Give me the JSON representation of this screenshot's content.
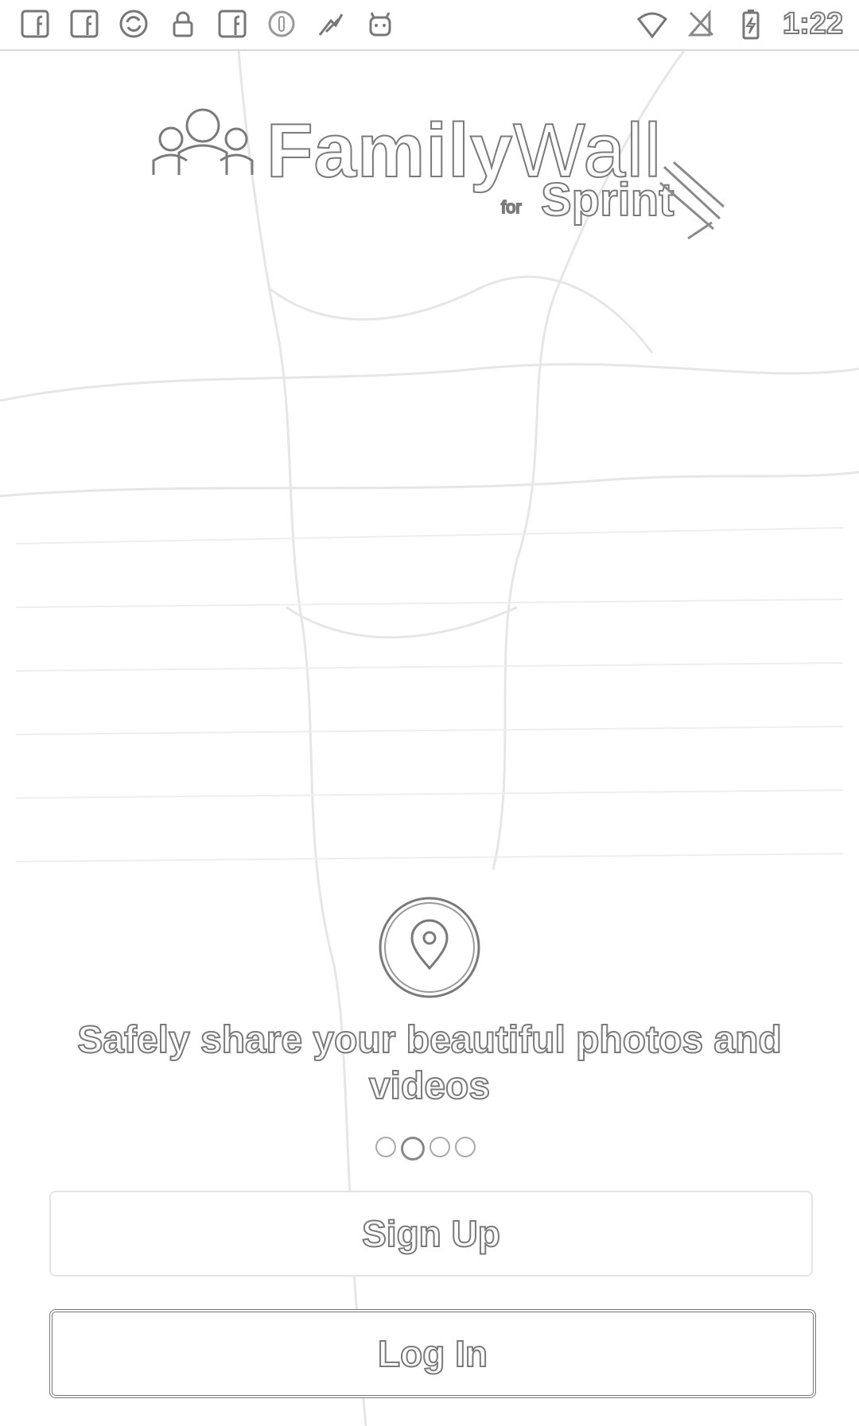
{
  "status_bar": {
    "left_icons": [
      "facebook-icon",
      "facebook-icon",
      "sync-icon",
      "lock-icon",
      "facebook-icon",
      "circle-i-icon",
      "fake-gps-icon",
      "android-icon"
    ],
    "right_icons": [
      "wifi-icon",
      "no-sim-icon",
      "battery-charging-icon"
    ],
    "time": "1:22"
  },
  "logo": {
    "family": "Family",
    "wall": "Wall",
    "for": "for",
    "sprint": "Sprint"
  },
  "onboarding": {
    "icon": "location-pin-icon",
    "caption": "Safely share your beautiful photos and videos",
    "pages_total": 4,
    "active_page": 2
  },
  "buttons": {
    "signup_label": "Sign Up",
    "login_label": "Log In"
  }
}
